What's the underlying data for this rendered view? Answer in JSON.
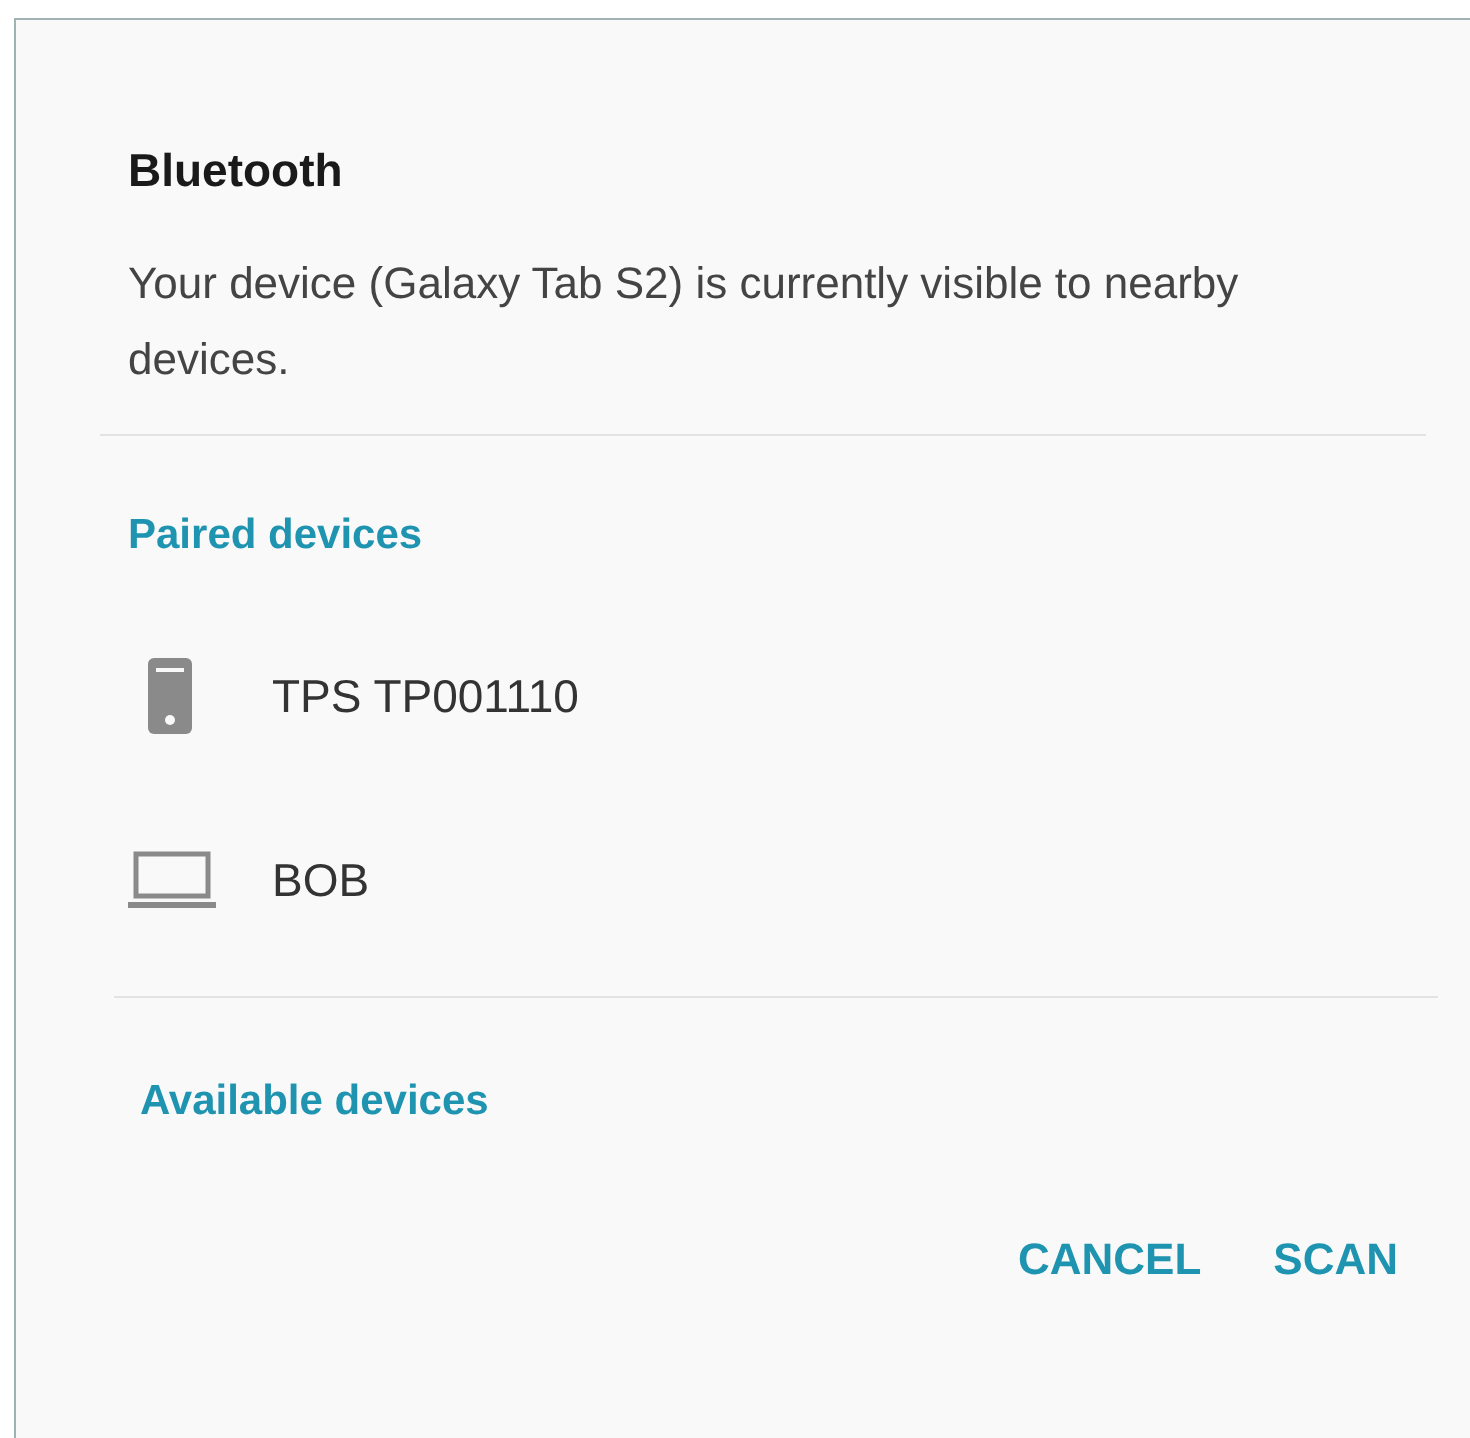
{
  "dialog": {
    "title": "Bluetooth",
    "message": "Your device (Galaxy Tab S2) is currently visible to nearby devices.",
    "paired_header": "Paired devices",
    "paired_devices": [
      {
        "name": "TPS TP001110",
        "kind": "phone"
      },
      {
        "name": "BOB",
        "kind": "laptop"
      }
    ],
    "available_header": "Available devices",
    "buttons": [
      "CANCEL",
      "SCAN"
    ]
  }
}
